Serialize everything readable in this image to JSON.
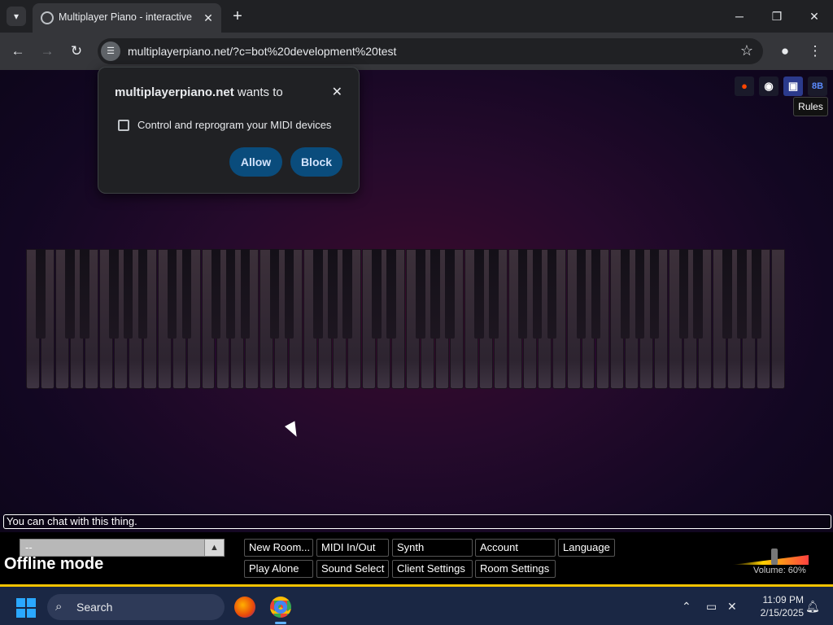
{
  "browser": {
    "tab_title": "Multiplayer Piano - interactive",
    "url": "multiplayerpiano.net/?c=bot%20development%20test",
    "window_buttons": [
      "─",
      "❐",
      "✕"
    ]
  },
  "permission_popup": {
    "site": "multiplayerpiano.net",
    "wants_to": "wants to",
    "request": "Control and reprogram your MIDI devices",
    "allow_label": "Allow",
    "block_label": "Block"
  },
  "page": {
    "rules_label": "Rules",
    "social_icons": [
      "reddit-icon",
      "github-icon",
      "discord-icon",
      "8b-icon"
    ],
    "social_labels": [
      "●",
      "◉",
      "▣",
      "8B"
    ],
    "chat_placeholder": "You can chat with this thing.",
    "room_select_value": "--",
    "status_text": "Offline mode",
    "buttons_row1": [
      "New Room...",
      "MIDI In/Out",
      "Synth",
      "Account",
      "Language"
    ],
    "buttons_row2": [
      "Play Alone",
      "Sound Select",
      "Client Settings",
      "Room Settings"
    ],
    "volume_label": "Volume: 60%",
    "volume_level": 0.6
  },
  "taskbar": {
    "search_label": "Search",
    "time": "11:09 PM",
    "date": "2/15/2025"
  },
  "colors": {
    "accent_button": "#0a4c7c",
    "taskbar_highlight": "#f2c200"
  }
}
